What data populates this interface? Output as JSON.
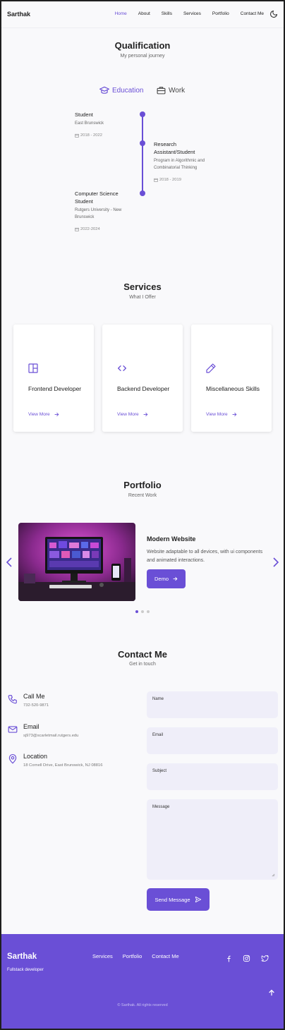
{
  "header": {
    "brand": "Sarthak",
    "nav": [
      "Home",
      "About",
      "Skills",
      "Services",
      "Portfolio",
      "Contact Me"
    ],
    "active_nav": "Home",
    "theme_icon": "moon-icon"
  },
  "qualification": {
    "title": "Qualification",
    "subtitle": "My personal journey",
    "tabs": {
      "education": "Education",
      "work": "Work"
    },
    "items": [
      {
        "title": "Student",
        "subtitle": "East Brunswick",
        "date": "2018 - 2022"
      },
      {
        "title": "Research Assistant/Student",
        "subtitle": "Program in Algorithmic and Combinatorial Thinking",
        "date": "2018 - 2019"
      },
      {
        "title": "Computer Science Student",
        "subtitle": "Rutgers University - New Brunswick",
        "date": "2022-2024"
      }
    ]
  },
  "services": {
    "title": "Services",
    "subtitle": "What I Offer",
    "cards": [
      {
        "title": "Frontend Developer",
        "link": "View More",
        "icon": "layout-icon"
      },
      {
        "title": "Backend Developer",
        "link": "View More",
        "icon": "code-icon"
      },
      {
        "title": "Miscellaneous Skills",
        "link": "View More",
        "icon": "pencil-icon"
      }
    ]
  },
  "portfolio": {
    "title": "Portfolio",
    "subtitle": "Recent Work",
    "project_title": "Modern Website",
    "project_desc": "Website adaptable to all devices, with ui components and animated interactions.",
    "demo_label": "Demo",
    "slides": 3,
    "active_slide": 1
  },
  "contact": {
    "title": "Contact Me",
    "subtitle": "Get in touch",
    "info": [
      {
        "title": "Call Me",
        "value": "732-520-9871",
        "icon": "phone-icon"
      },
      {
        "title": "Email",
        "value": "sj973@scarletmail.rutgers.edu",
        "icon": "mail-icon"
      },
      {
        "title": "Location",
        "value": "18 Cornell Drive, East Brunswick, NJ 08816",
        "icon": "location-icon"
      }
    ],
    "fields": {
      "name": "Name",
      "email": "Email",
      "subject": "Subject",
      "message": "Message"
    },
    "send_label": "Send Message"
  },
  "footer": {
    "brand": "Sarthak",
    "role": "Fullstack developer",
    "links": [
      "Services",
      "Portfolio",
      "Contact Me"
    ],
    "social": [
      "facebook-icon",
      "instagram-icon",
      "twitter-icon"
    ],
    "copyright": "© Sarthak. All rights reserved"
  },
  "colors": {
    "accent": "#6a4fd6",
    "background": "#f9f9fb",
    "field": "#efeef9"
  }
}
